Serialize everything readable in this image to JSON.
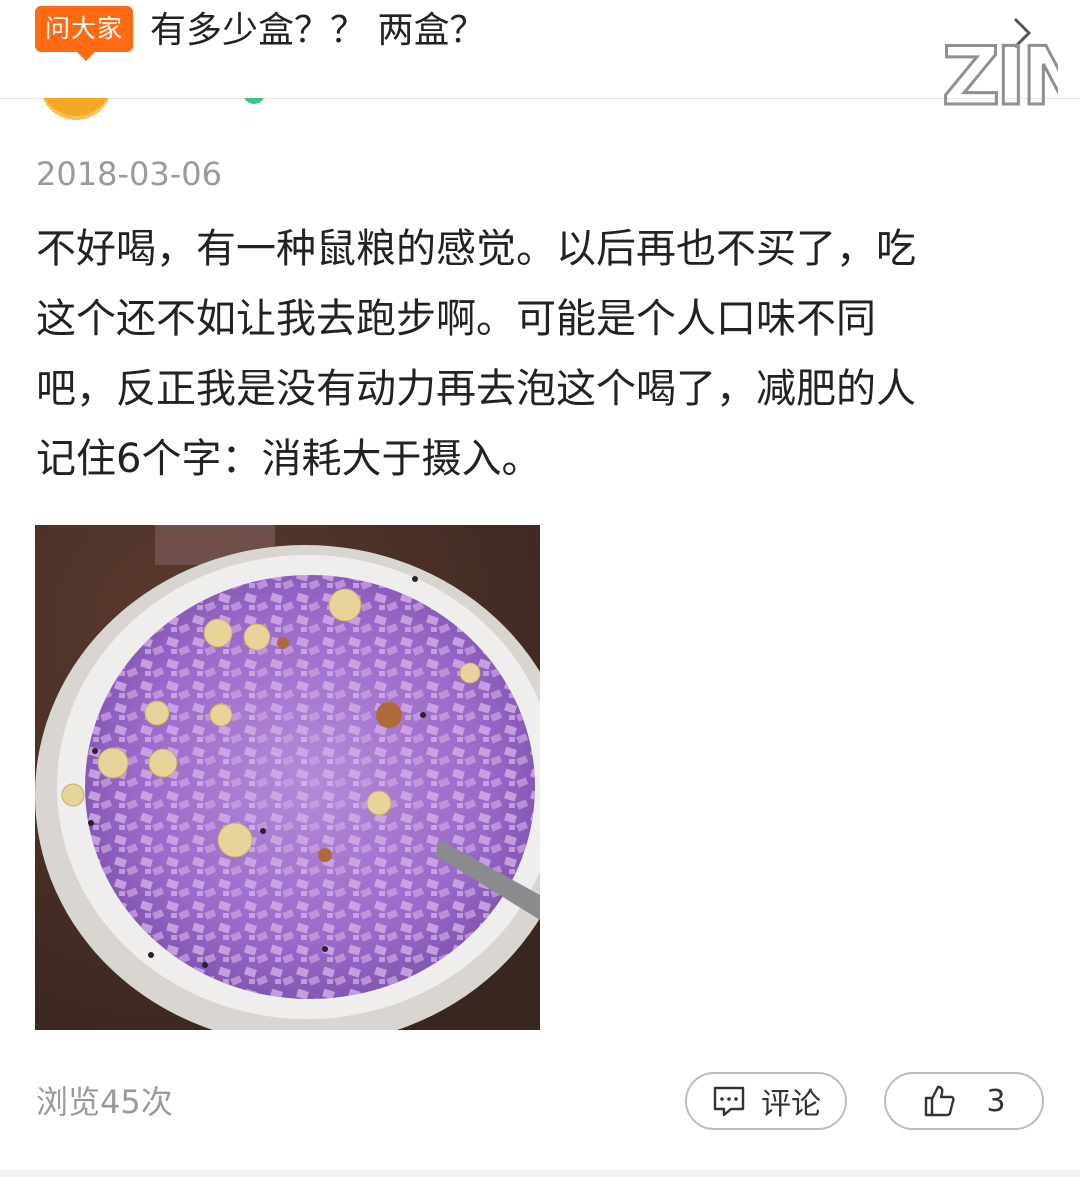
{
  "header": {
    "badge_label": "问大家",
    "question": "有多少盒？？ 两盒？",
    "watermark_text": "ZIN"
  },
  "post": {
    "date": "2018-03-06",
    "review_lines": [
      "不好喝，有一种鼠粮的感觉。以后再也不买了，吃",
      "这个还不如让我去跑步啊。可能是个人口味不同",
      "吧，反正我是没有动力再去泡这个喝了，减肥的人",
      "记住6个字：消耗大于摄入。"
    ]
  },
  "footer": {
    "views": "浏览45次",
    "comment_label": "评论",
    "like_count": "3"
  },
  "colors": {
    "badge": "#ff6a13",
    "muted_text": "#9a9a9a",
    "button_border": "#bdbdbd",
    "porridge": "#a978d2"
  },
  "icons": [
    "chevron-right-icon",
    "comment-icon",
    "thumbs-up-icon"
  ]
}
